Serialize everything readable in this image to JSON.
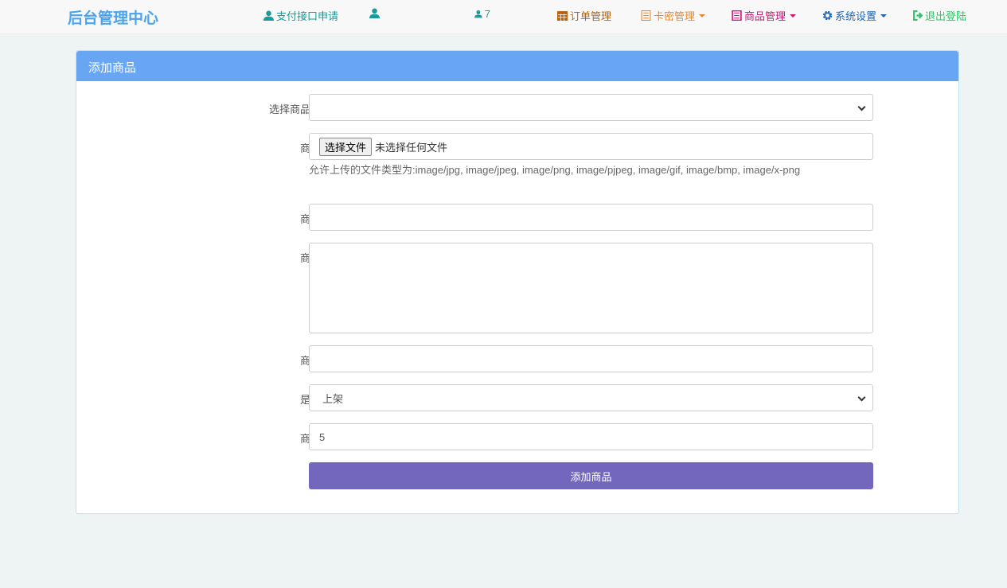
{
  "navbar": {
    "brand": "后台管理中心",
    "items": [
      {
        "label": "支付接口申请",
        "icon": "user-icon",
        "color": "#1a9a9a"
      },
      {
        "label": "",
        "icon": "user-icon",
        "color": "#1a9a9a"
      },
      {
        "label": "7",
        "icon": "user-icon",
        "color": "#1a9a9a"
      },
      {
        "label": "订单管理",
        "icon": "calendar-icon",
        "color": "#b8600a"
      },
      {
        "label": "卡密管理",
        "icon": "list-icon",
        "color": "#e8892f",
        "dropdown": true
      },
      {
        "label": "商品管理",
        "icon": "list-icon",
        "color": "#d4127a",
        "dropdown": true
      },
      {
        "label": "系统设置",
        "icon": "gear-icon",
        "color": "#1f63b0",
        "dropdown": true
      },
      {
        "label": "退出登陆",
        "icon": "logout-icon",
        "color": "#2fc468"
      }
    ]
  },
  "panel": {
    "title": "添加商品",
    "fields": {
      "category": {
        "label": "选择商品的分类",
        "value": ""
      },
      "image": {
        "label": "商品图片",
        "button": "选择文件",
        "status": "未选择任何文件",
        "help": "允许上传的文件类型为:image/jpg, image/jpeg, image/png, image/pjpeg, image/gif, image/bmp, image/x-png"
      },
      "name": {
        "label": "商品名称",
        "value": ""
      },
      "intro": {
        "label": "商品介绍",
        "value": ""
      },
      "price": {
        "label": "商品价格",
        "value": ""
      },
      "listed": {
        "label": "是否上架",
        "value": "上架"
      },
      "sort": {
        "label": "商品排序",
        "value": "5"
      }
    },
    "submit": "添加商品"
  }
}
